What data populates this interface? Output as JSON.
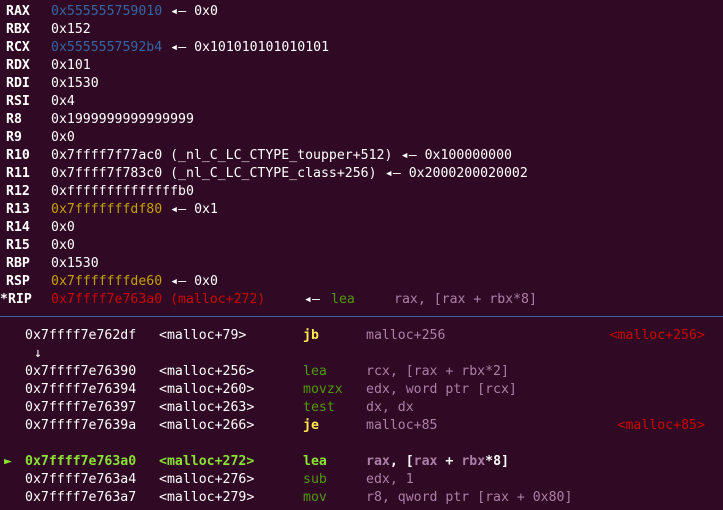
{
  "registers": [
    {
      "name": "RAX",
      "value": "0x555555759010",
      "value_color": "blue",
      "arrow": "◂— 0x0",
      "arrow_color": "white"
    },
    {
      "name": "RBX",
      "value": "0x152",
      "value_color": "white",
      "arrow": "",
      "arrow_color": "white"
    },
    {
      "name": "RCX",
      "value": "0x5555557592b4",
      "value_color": "blue",
      "arrow": "◂— 0x101010101010101",
      "arrow_color": "white"
    },
    {
      "name": "RDX",
      "value": "0x101",
      "value_color": "white",
      "arrow": "",
      "arrow_color": "white"
    },
    {
      "name": "RDI",
      "value": "0x1530",
      "value_color": "white",
      "arrow": "",
      "arrow_color": "white"
    },
    {
      "name": "RSI",
      "value": "0x4",
      "value_color": "white",
      "arrow": "",
      "arrow_color": "white"
    },
    {
      "name": "R8",
      "value": "0x1999999999999999",
      "value_color": "white",
      "arrow": "",
      "arrow_color": "white"
    },
    {
      "name": "R9",
      "value": "0x0",
      "value_color": "white",
      "arrow": "",
      "arrow_color": "white"
    },
    {
      "name": "R10",
      "value": "0x7ffff7f77ac0 (_nl_C_LC_CTYPE_toupper+512)",
      "value_color": "white",
      "arrow": "◂— 0x100000000",
      "arrow_color": "white"
    },
    {
      "name": "R11",
      "value": "0x7ffff7f783c0 (_nl_C_LC_CTYPE_class+256)",
      "value_color": "white",
      "arrow": "◂— 0x2000200020002",
      "arrow_color": "white"
    },
    {
      "name": "R12",
      "value": "0xffffffffffffffb0",
      "value_color": "white",
      "arrow": "",
      "arrow_color": "white"
    },
    {
      "name": "R13",
      "value": "0x7fffffffdf80",
      "value_color": "yellow",
      "arrow": "◂— 0x1",
      "arrow_color": "white"
    },
    {
      "name": "R14",
      "value": "0x0",
      "value_color": "white",
      "arrow": "",
      "arrow_color": "white"
    },
    {
      "name": "R15",
      "value": "0x0",
      "value_color": "white",
      "arrow": "",
      "arrow_color": "white"
    },
    {
      "name": "RBP",
      "value": "0x1530",
      "value_color": "white",
      "arrow": "",
      "arrow_color": "white"
    },
    {
      "name": "RSP",
      "value": "0x7fffffffde60",
      "value_color": "yellow",
      "arrow": "◂— 0x0",
      "arrow_color": "white"
    }
  ],
  "rip": {
    "name": "*RIP",
    "value": "0x7ffff7e763a0 (malloc+272)",
    "arrow": "◂—",
    "mnemonic": "lea",
    "operands": "rax, [rax + rbx*8]"
  },
  "disasm": [
    {
      "addr": "0x7ffff7e762df",
      "sym": "<malloc+79>",
      "mnem": "jb",
      "mnem_style": "yellowb",
      "ops": "malloc+256",
      "ops_style": "lpurple",
      "target": "<malloc+256>",
      "current": false
    },
    {
      "addr": "",
      "sym": "",
      "mnem": "",
      "mnem_style": "white",
      "ops": "",
      "ops_style": "white",
      "target": "",
      "current": false,
      "jump_arrow": "↓"
    },
    {
      "addr": "0x7ffff7e76390",
      "sym": "<malloc+256>",
      "mnem": "lea",
      "mnem_style": "green",
      "ops": "rcx, [rax + rbx*2]",
      "ops_style": "lpurple",
      "target": "",
      "current": false
    },
    {
      "addr": "0x7ffff7e76394",
      "sym": "<malloc+260>",
      "mnem": "movzx",
      "mnem_style": "green",
      "ops": "edx, word ptr [rcx]",
      "ops_style": "lpurple",
      "target": "",
      "current": false
    },
    {
      "addr": "0x7ffff7e76397",
      "sym": "<malloc+263>",
      "mnem": "test",
      "mnem_style": "green",
      "ops": "dx, dx",
      "ops_style": "lpurple",
      "target": "",
      "current": false
    },
    {
      "addr": "0x7ffff7e7639a",
      "sym": "<malloc+266>",
      "mnem": "je",
      "mnem_style": "yellowb",
      "ops": "malloc+85",
      "ops_style": "lpurple",
      "target": "<malloc+85>",
      "current": false
    },
    {
      "addr": "",
      "sym": "",
      "mnem": "",
      "mnem_style": "white",
      "ops": "",
      "ops_style": "white",
      "target": "",
      "current": false
    },
    {
      "addr": "0x7ffff7e763a0",
      "sym": "<malloc+272>",
      "mnem": "lea",
      "mnem_style": "bgreen",
      "ops": "rax, [rax + rbx*8]",
      "ops_style": "current",
      "target": "",
      "current": true,
      "marker": "►"
    },
    {
      "addr": "0x7ffff7e763a4",
      "sym": "<malloc+276>",
      "mnem": "sub",
      "mnem_style": "green",
      "ops": "edx, 1",
      "ops_style": "lpurple",
      "target": "",
      "current": false
    },
    {
      "addr": "0x7ffff7e763a7",
      "sym": "<malloc+279>",
      "mnem": "mov",
      "mnem_style": "green",
      "ops": "r8, qword ptr [rax + 0x80]",
      "ops_style": "lpurple",
      "target": "",
      "current": false
    }
  ],
  "colors": {
    "background": "#300a24",
    "pointer_heap": "#3465a4",
    "pointer_stack": "#c4a000",
    "pointer_code": "#cc0000",
    "mnemonic": "#4e9a06",
    "branch": "#fce94f",
    "current": "#8ae234",
    "separator": "#3465a4"
  }
}
